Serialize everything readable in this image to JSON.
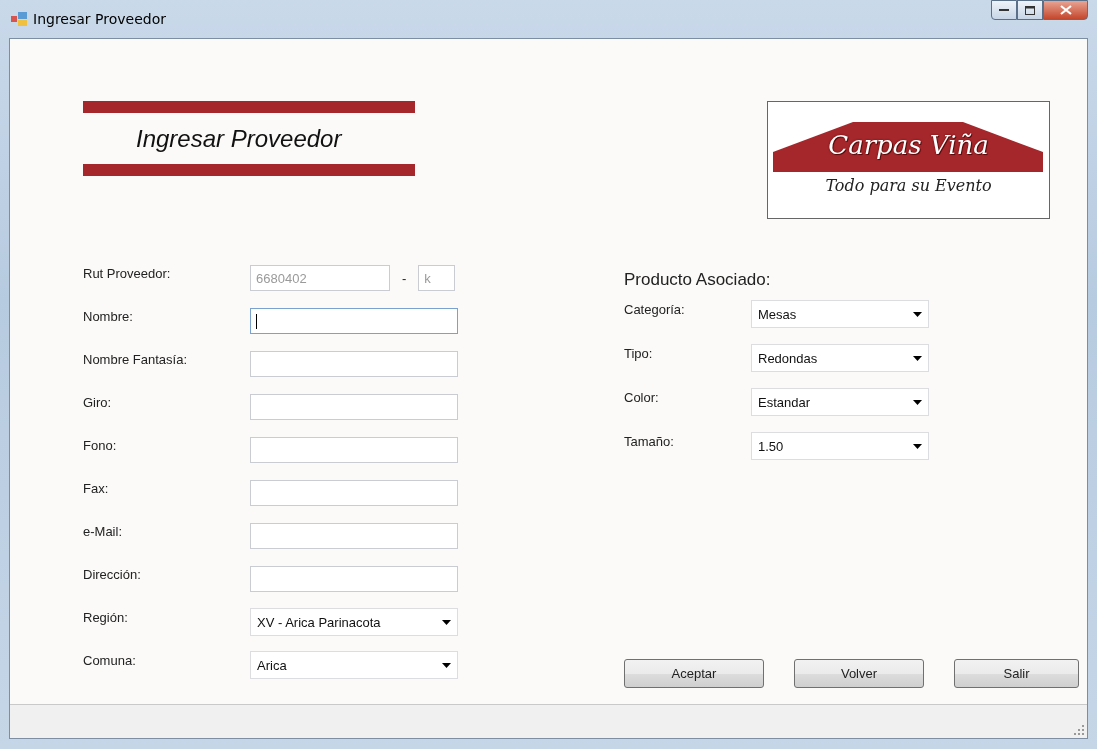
{
  "window": {
    "title": "Ingresar Proveedor"
  },
  "header": {
    "title": "Ingresar Proveedor"
  },
  "logo": {
    "name": "Carpas Viña",
    "slogan": "Todo para su Evento"
  },
  "proveedor_fields": [
    {
      "label": "Rut Proveedor:",
      "kind": "rut",
      "value": "6680402",
      "separator": "-",
      "check_digit": "k",
      "disabled": true
    },
    {
      "label": "Nombre:",
      "kind": "text",
      "focused": true
    },
    {
      "label": "Nombre Fantasía:",
      "kind": "text",
      "focused": false
    },
    {
      "label": "Giro:",
      "kind": "text",
      "focused": false
    },
    {
      "label": "Fono:",
      "kind": "text",
      "focused": false
    },
    {
      "label": "Fax:",
      "kind": "text",
      "focused": false
    },
    {
      "label": "e-Mail:",
      "kind": "text",
      "focused": false
    },
    {
      "label": "Dirección:",
      "kind": "text",
      "focused": false
    },
    {
      "label": "Región:",
      "kind": "combo",
      "value": "XV - Arica Parinacota"
    },
    {
      "label": "Comuna:",
      "kind": "combo",
      "value": "Arica"
    }
  ],
  "producto": {
    "title": "Producto Asociado:",
    "fields": [
      {
        "label": "Categoría:",
        "value": "Mesas"
      },
      {
        "label": "Tipo:",
        "value": "Redondas"
      },
      {
        "label": "Color:",
        "value": "Estandar"
      },
      {
        "label": "Tamaño:",
        "value": "1.50"
      }
    ]
  },
  "buttons": [
    "Aceptar",
    "Volver",
    "Salir"
  ]
}
